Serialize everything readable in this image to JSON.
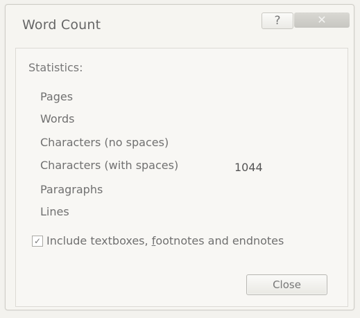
{
  "window": {
    "title": "Word Count",
    "help_label": "?",
    "close_glyph": "✕"
  },
  "statistics": {
    "heading": "Statistics:",
    "rows": [
      {
        "label": "Pages",
        "value": ""
      },
      {
        "label": "Words",
        "value": ""
      },
      {
        "label": "Characters (no spaces)",
        "value": ""
      },
      {
        "label": "Characters (with spaces)",
        "value": "1044"
      },
      {
        "label": "Paragraphs",
        "value": ""
      },
      {
        "label": "Lines",
        "value": ""
      }
    ]
  },
  "options": {
    "include_checkbox_checked": true,
    "include_label_pre": "Include textboxes, ",
    "include_label_underlined": "f",
    "include_label_post": "ootnotes and endnotes"
  },
  "buttons": {
    "close_label": "Close"
  }
}
